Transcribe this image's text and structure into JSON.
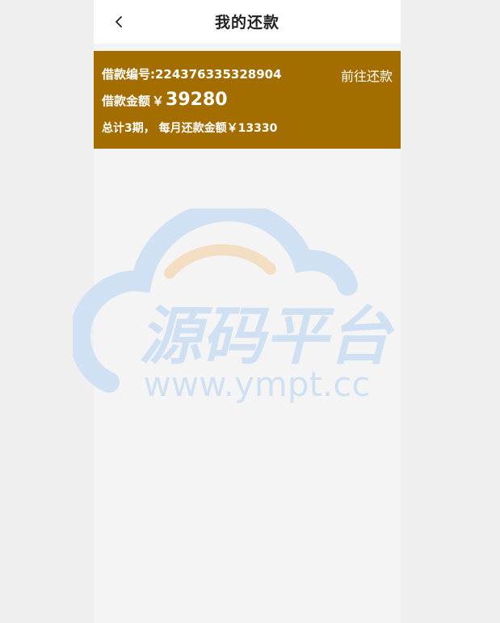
{
  "header": {
    "title": "我的还款",
    "back_icon": "chevron-left-icon"
  },
  "loan": {
    "number_label": "借款编号:",
    "number": "224376335328904",
    "action_label": "前往还款",
    "amount_label": "借款金额",
    "currency_symbol": "￥",
    "amount": "39280",
    "summary": "总计3期， 每月还款金额￥13330"
  },
  "watermark": {
    "main_text": "源码平台",
    "url_text": "www.ympt.cc"
  },
  "colors": {
    "card_background": "#a46d00",
    "page_background": "#f4f4f4",
    "outer_background": "#efefef",
    "watermark_blue": "#cfdff3",
    "watermark_orange": "#f3dcc0"
  }
}
